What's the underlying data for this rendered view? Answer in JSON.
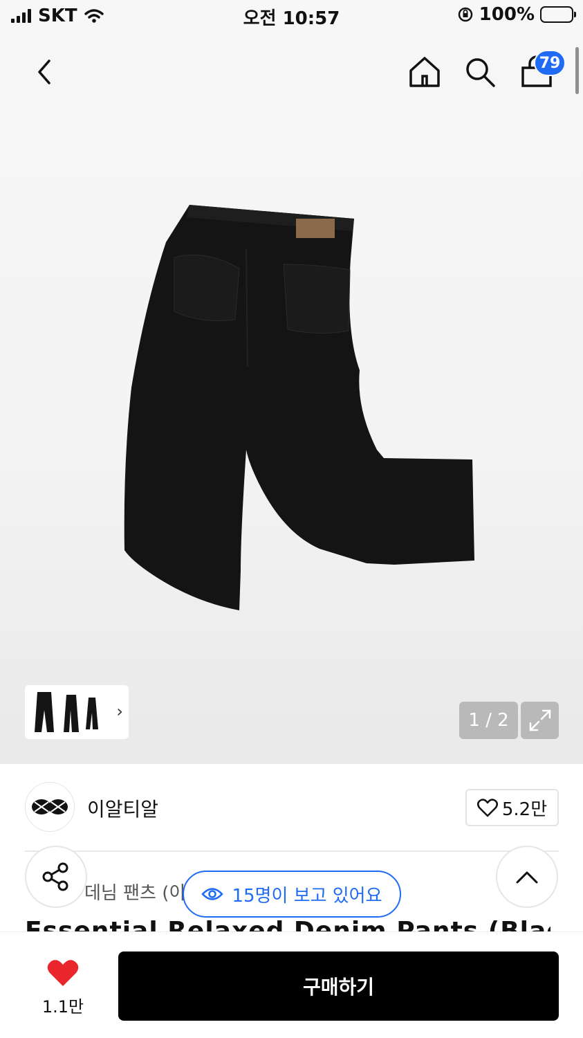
{
  "status_bar": {
    "carrier": "SKT",
    "time": "오전 10:57",
    "battery": "100%"
  },
  "nav": {
    "cart_count": "79"
  },
  "gallery": {
    "pager": "1 / 2"
  },
  "brand": {
    "name": "이알티알",
    "likes": "5.2만"
  },
  "product": {
    "category": "데님 팬츠 (이",
    "title": "Essential Relaxed Denim Pants (Black)"
  },
  "viewers": {
    "text": "15명이 보고 있어요"
  },
  "bottom_bar": {
    "like_count": "1.1만",
    "buy_label": "구매하기"
  },
  "colors": {
    "accent_blue": "#1f6bf5",
    "heart_red": "#e8262c",
    "buy_button": "#000000"
  }
}
